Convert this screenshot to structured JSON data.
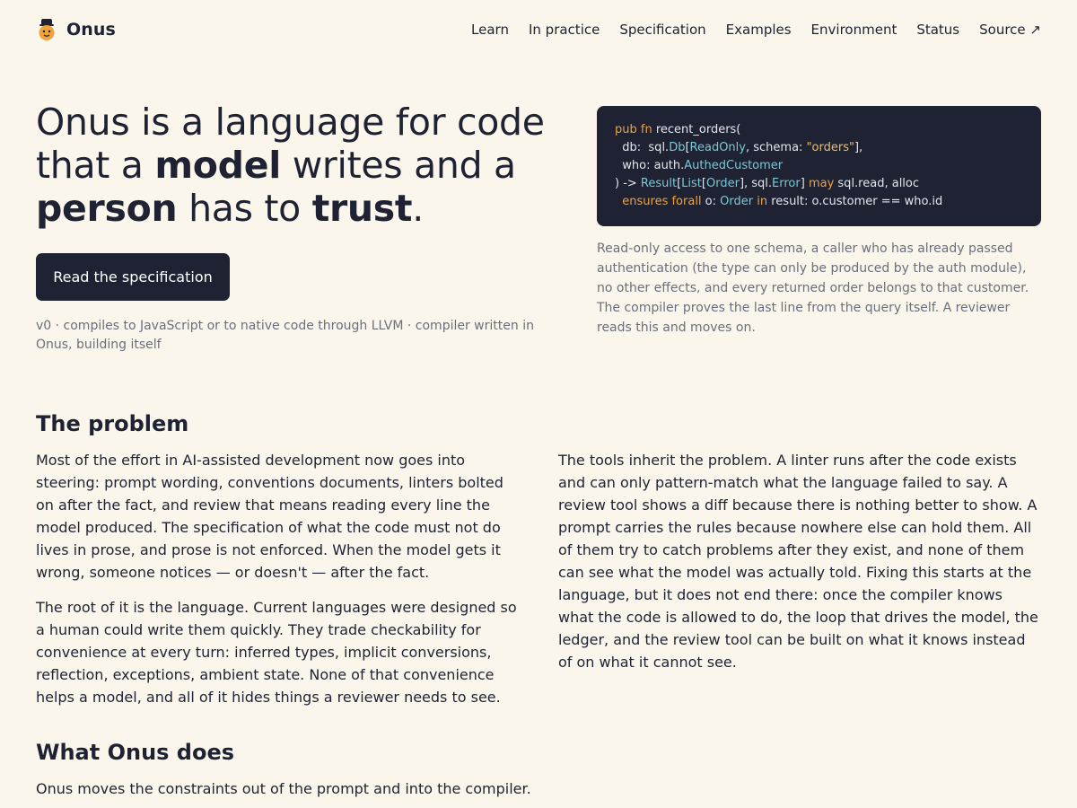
{
  "brand": {
    "name": "Onus"
  },
  "nav": {
    "items": [
      "Learn",
      "In practice",
      "Specification",
      "Examples",
      "Environment",
      "Status",
      "Source ↗"
    ]
  },
  "hero": {
    "headline_parts": [
      "Onus is a language for code that a ",
      "model",
      " writes and a ",
      "person",
      " has to ",
      "trust",
      "."
    ],
    "cta_label": "Read the specification",
    "meta": "v0 · compiles to JavaScript or to native code through LLVM · compiler written in Onus, building itself",
    "code_lines": [
      [
        [
          "kw",
          "pub fn"
        ],
        [
          "t",
          " recent_orders("
        ]
      ],
      [
        [
          "t",
          "  db:  sql."
        ],
        [
          "ty",
          "Db"
        ],
        [
          "t",
          "["
        ],
        [
          "ty",
          "ReadOnly"
        ],
        [
          "t",
          ", schema: "
        ],
        [
          "st",
          "\"orders\""
        ],
        [
          "t",
          "],"
        ]
      ],
      [
        [
          "t",
          "  who: auth."
        ],
        [
          "ty",
          "AuthedCustomer"
        ]
      ],
      [
        [
          "t",
          ") -> "
        ],
        [
          "ty",
          "Result"
        ],
        [
          "t",
          "["
        ],
        [
          "ty",
          "List"
        ],
        [
          "t",
          "["
        ],
        [
          "ty",
          "Order"
        ],
        [
          "t",
          "], sql."
        ],
        [
          "ty",
          "Error"
        ],
        [
          "t",
          "] "
        ],
        [
          "kw",
          "may"
        ],
        [
          "t",
          " sql.read, alloc"
        ]
      ],
      [
        [
          "t",
          "  "
        ],
        [
          "kw",
          "ensures forall"
        ],
        [
          "t",
          " o: "
        ],
        [
          "ty",
          "Order"
        ],
        [
          "t",
          " "
        ],
        [
          "kw",
          "in"
        ],
        [
          "t",
          " result: o.customer == who.id"
        ]
      ]
    ],
    "caption": "Read-only access to one schema, a caller who has already passed authentication (the type can only be produced by the auth module), no other effects, and every returned order belongs to that customer. The compiler proves the last line from the query itself. A reviewer reads this and moves on."
  },
  "problem": {
    "title": "The problem",
    "left": [
      "Most of the effort in AI-assisted development now goes into steering: prompt wording, conventions documents, linters bolted on after the fact, and review that means reading every line the model produced. The specification of what the code must not do lives in prose, and prose is not enforced. When the model gets it wrong, someone notices — or doesn't — after the fact.",
      "The root of it is the language. Current languages were designed so a human could write them quickly. They trade checkability for convenience at every turn: inferred types, implicit conversions, reflection, exceptions, ambient state. None of that convenience helps a model, and all of it hides things a reviewer needs to see."
    ],
    "right": [
      "The tools inherit the problem. A linter runs after the code exists and can only pattern-match what the language failed to say. A review tool shows a diff because there is nothing better to show. A prompt carries the rules because nowhere else can hold them. All of them try to catch problems after they exist, and none of them can see what the model was actually told. Fixing this starts at the language, but it does not end there: once the compiler knows what the code is allowed to do, the loop that drives the model, the ledger, and the review tool can be built on what it knows instead of on what it cannot see."
    ]
  },
  "does": {
    "title": "What Onus does",
    "lead": "Onus moves the constraints out of the prompt and into the compiler."
  },
  "colors": {
    "background": "#faf6ec",
    "ink": "#1e2233",
    "muted": "#6b6f7b",
    "code_keyword": "#f0a23b",
    "code_type": "#79c9d6",
    "code_string": "#e8c170"
  },
  "icons": {
    "brand": "onus-mascot-icon"
  }
}
